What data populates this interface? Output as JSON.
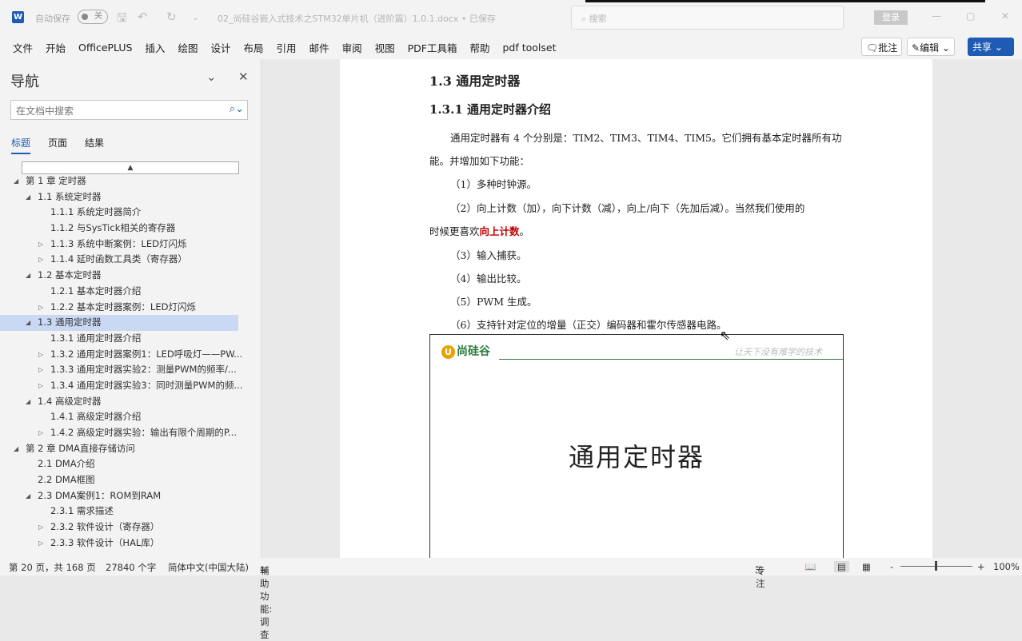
{
  "titlebar": {
    "app_icon": "W",
    "autosave_label": "自动保存",
    "autosave_state": "关",
    "doc_title": "02_尚硅谷嵌入式技术之STM32单片机（进阶篇）1.0.1.docx • 已保存",
    "search_placeholder": "搜索",
    "login": "登录"
  },
  "menu": [
    "文件",
    "开始",
    "OfficePLUS",
    "插入",
    "绘图",
    "设计",
    "布局",
    "引用",
    "邮件",
    "审阅",
    "视图",
    "PDF工具箱",
    "帮助",
    "pdf toolset"
  ],
  "ribbon_right": {
    "comment": "批注",
    "edit": "编辑",
    "share": "共享"
  },
  "nav": {
    "title": "导航",
    "search_placeholder": "在文档中搜索",
    "tabs": [
      "标题",
      "页面",
      "结果"
    ],
    "items": [
      {
        "label": "第 1 章 定时器",
        "level": 0,
        "state": "expanded"
      },
      {
        "label": "1.1 系统定时器",
        "level": 1,
        "state": "expanded"
      },
      {
        "label": "1.1.1 系统定时器简介",
        "level": 2,
        "state": "none"
      },
      {
        "label": "1.1.2 与SysTick相关的寄存器",
        "level": 2,
        "state": "none"
      },
      {
        "label": "1.1.3 系统中断案例：LED灯闪烁",
        "level": 2,
        "state": "collapsed"
      },
      {
        "label": "1.1.4 延时函数工具类（寄存器）",
        "level": 2,
        "state": "collapsed"
      },
      {
        "label": "1.2 基本定时器",
        "level": 1,
        "state": "expanded"
      },
      {
        "label": "1.2.1 基本定时器介绍",
        "level": 2,
        "state": "none"
      },
      {
        "label": "1.2.2 基本定时器案例：LED灯闪烁",
        "level": 2,
        "state": "collapsed"
      },
      {
        "label": "1.3 通用定时器",
        "level": 1,
        "state": "expanded",
        "selected": true
      },
      {
        "label": "1.3.1 通用定时器介绍",
        "level": 2,
        "state": "none"
      },
      {
        "label": "1.3.2 通用定时器案例1：LED呼吸灯——PW...",
        "level": 2,
        "state": "collapsed"
      },
      {
        "label": "1.3.3 通用定时器实验2：测量PWM的频率/...",
        "level": 2,
        "state": "collapsed"
      },
      {
        "label": "1.3.4 通用定时器实验3：同时测量PWM的频...",
        "level": 2,
        "state": "collapsed"
      },
      {
        "label": "1.4 高级定时器",
        "level": 1,
        "state": "expanded"
      },
      {
        "label": "1.4.1 高级定时器介绍",
        "level": 2,
        "state": "none"
      },
      {
        "label": "1.4.2 高级定时器实验：输出有限个周期的P...",
        "level": 2,
        "state": "collapsed"
      },
      {
        "label": "第 2 章 DMA直接存储访问",
        "level": 0,
        "state": "expanded"
      },
      {
        "label": "2.1 DMA介绍",
        "level": 1,
        "state": "none"
      },
      {
        "label": "2.2 DMA框图",
        "level": 1,
        "state": "none"
      },
      {
        "label": "2.3 DMA案例1：ROM到RAM",
        "level": 1,
        "state": "expanded"
      },
      {
        "label": "2.3.1 需求描述",
        "level": 2,
        "state": "none"
      },
      {
        "label": "2.3.2 软件设计（寄存器）",
        "level": 2,
        "state": "collapsed"
      },
      {
        "label": "2.3.3 软件设计（HAL库）",
        "level": 2,
        "state": "collapsed"
      }
    ]
  },
  "doc": {
    "h2": "1.3 通用定时器",
    "h3": "1.3.1 通用定时器介绍",
    "p1a": "通用定时器有 4 个分别是：TIM2、TIM3、TIM4、TIM5。它们拥有基本定时器所有功",
    "p1b": "能。并增加如下功能：",
    "l1": "（1）多种时钟源。",
    "l2a": "（2）向上计数（加），向下计数（减），向上/向下（先加后减）。当然我们使用的",
    "l2b": "时候更喜欢",
    "l2red": "向上计数",
    "l2end": "。",
    "l3": "（3）输入捕获。",
    "l4": "（4）输出比较。",
    "l5": "（5）PWM 生成。",
    "l6": "（6）支持针对定位的增量（正交）编码器和霍尔传感器电路。",
    "slide": {
      "logo": "尚硅谷",
      "slogan": "让天下没有难学的技术",
      "title": "通用定时器"
    }
  },
  "status": {
    "page": "第 20 页，共 168 页",
    "words": "27840 个字",
    "lang": "简体中文(中国大陆)",
    "access": "辅助功能: 调查",
    "focus": "专注",
    "zoom": "100%"
  }
}
